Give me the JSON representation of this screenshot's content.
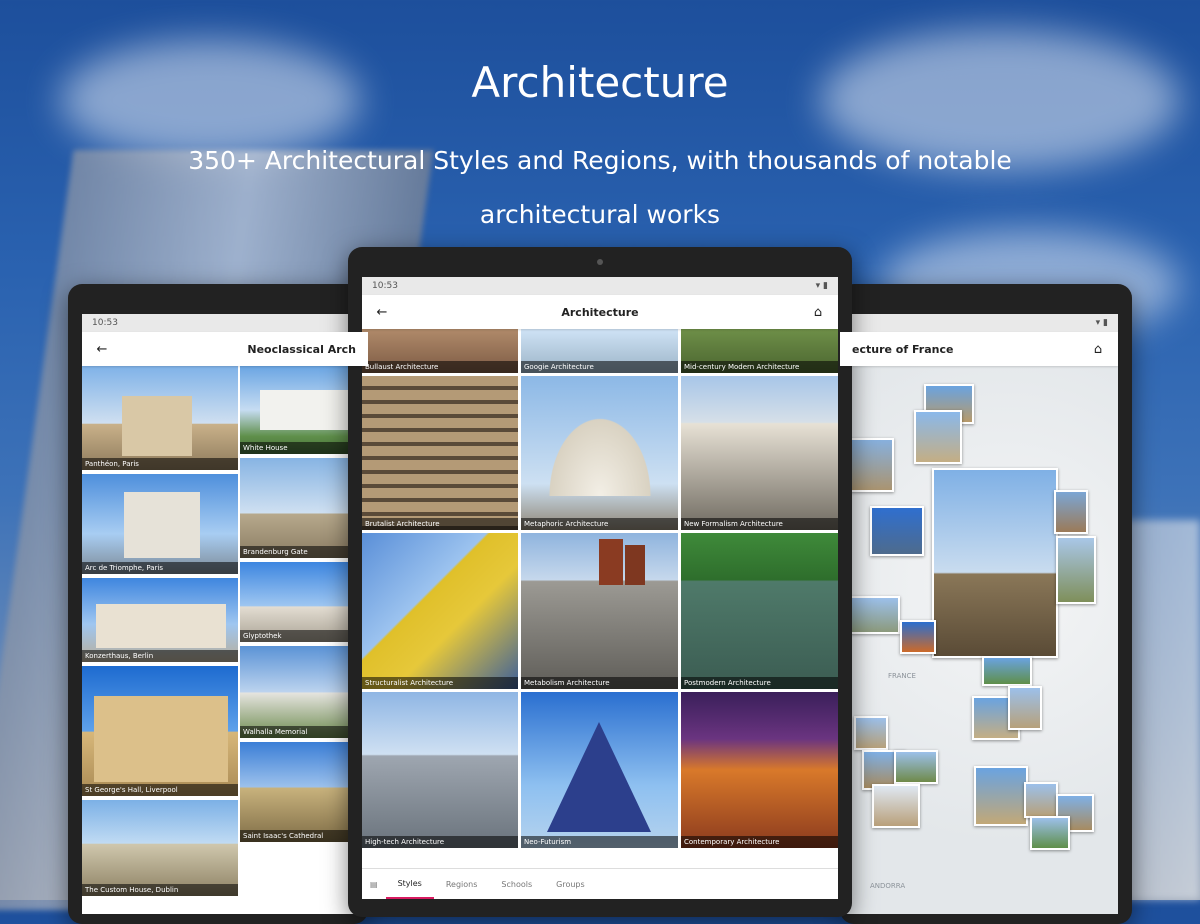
{
  "promo": {
    "title": "Architecture",
    "subtitle": "350+ Architectural Styles and Regions, with thousands of notable architectural works"
  },
  "left_tablet": {
    "status_time": "10:53",
    "title": "Neoclassical Arch",
    "tiles": [
      {
        "label": "Panthéon, Paris"
      },
      {
        "label": "White House"
      },
      {
        "label": "Arc de Triomphe, Paris"
      },
      {
        "label": "Brandenburg Gate"
      },
      {
        "label": "Konzerthaus, Berlin"
      },
      {
        "label": "Glyptothek"
      },
      {
        "label": "St George's Hall, Liverpool"
      },
      {
        "label": "Walhalla Memorial"
      },
      {
        "label": "The Custom House, Dublin"
      },
      {
        "label": "Saint Isaac's Cathedral"
      }
    ]
  },
  "center_tablet": {
    "status_time": "10:53",
    "title": "Architecture",
    "tiles": [
      {
        "label": "Bullaust Architecture"
      },
      {
        "label": "Googie Architecture"
      },
      {
        "label": "Mid-century Modern Architecture"
      },
      {
        "label": "Brutalist Architecture"
      },
      {
        "label": "Metaphoric Architecture"
      },
      {
        "label": "New Formalism Architecture"
      },
      {
        "label": "Structuralist Architecture"
      },
      {
        "label": "Metabolism Architecture"
      },
      {
        "label": "Postmodern Architecture"
      },
      {
        "label": "High-tech Architecture"
      },
      {
        "label": "Neo-Futurism"
      },
      {
        "label": "Contemporary Architecture"
      }
    ],
    "tabs": [
      "Styles",
      "Regions",
      "Schools",
      "Groups"
    ]
  },
  "right_tablet": {
    "title": "ecture of France",
    "map_labels": [
      "FRANCE",
      "ANDORRA"
    ]
  },
  "colors": {
    "accent": "#d81b60",
    "sky": "#2a62b0"
  }
}
